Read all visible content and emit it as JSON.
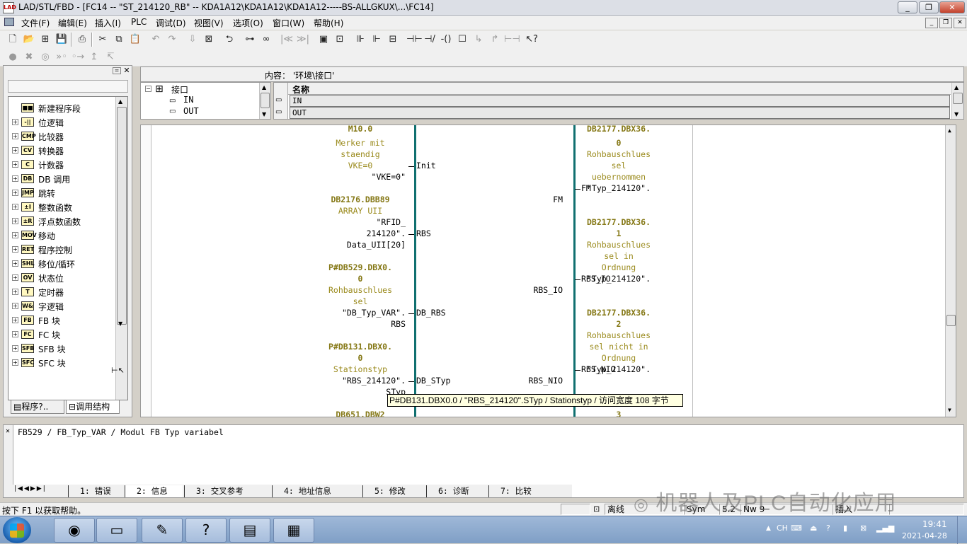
{
  "window": {
    "title": "LAD/STL/FBD  - [FC14 -- \"ST_214120_RB\" -- KDA1A12\\KDA1A12\\KDA1A12-----BS-ALLGKUX\\...\\FC14]",
    "app_icon_text": "LAD",
    "minimize": "_",
    "restore": "❐",
    "close": "✕"
  },
  "menu": {
    "items": [
      "文件(F)",
      "编辑(E)",
      "插入(I)",
      "PLC",
      "调试(D)",
      "视图(V)",
      "选项(O)",
      "窗口(W)",
      "帮助(H)"
    ],
    "mdi_min": "_",
    "mdi_restore": "❐",
    "mdi_close": "✕"
  },
  "left_panel": {
    "tree": [
      {
        "label": "新建程序段",
        "icon": "new-network-icon",
        "icon_text": "■■",
        "expandable": false
      },
      {
        "label": "位逻辑",
        "icon": "bit-logic-icon",
        "icon_text": "-||",
        "expandable": true
      },
      {
        "label": "比较器",
        "icon": "comparator-icon",
        "icon_text": "CMP",
        "expandable": true
      },
      {
        "label": "转换器",
        "icon": "converter-icon",
        "icon_text": "CV",
        "expandable": true
      },
      {
        "label": "计数器",
        "icon": "counter-icon",
        "icon_text": "C",
        "expandable": true
      },
      {
        "label": "DB 调用",
        "icon": "db-call-icon",
        "icon_text": "DB",
        "expandable": true
      },
      {
        "label": "跳转",
        "icon": "jump-icon",
        "icon_text": "JMP",
        "expandable": true
      },
      {
        "label": "整数函数",
        "icon": "integer-icon",
        "icon_text": "±I",
        "expandable": true
      },
      {
        "label": "浮点数函数",
        "icon": "float-icon",
        "icon_text": "±R",
        "expandable": true
      },
      {
        "label": "移动",
        "icon": "move-icon",
        "icon_text": "MOV",
        "expandable": true
      },
      {
        "label": "程序控制",
        "icon": "program-control-icon",
        "icon_text": "RET",
        "expandable": true
      },
      {
        "label": "移位/循环",
        "icon": "shift-icon",
        "icon_text": "SHL",
        "expandable": true
      },
      {
        "label": "状态位",
        "icon": "status-bit-icon",
        "icon_text": "OV",
        "expandable": true
      },
      {
        "label": "定时器",
        "icon": "timer-icon",
        "icon_text": "T",
        "expandable": true
      },
      {
        "label": "字逻辑",
        "icon": "word-logic-icon",
        "icon_text": "W&",
        "expandable": true
      },
      {
        "label": "FB 块",
        "icon": "fb-block-icon",
        "icon_text": "FB",
        "expandable": true
      },
      {
        "label": "FC 块",
        "icon": "fc-block-icon",
        "icon_text": "FC",
        "expandable": true
      },
      {
        "label": "SFB 块",
        "icon": "sfb-block-icon",
        "icon_text": "SFB",
        "expandable": true
      },
      {
        "label": "SFC 块",
        "icon": "sfc-block-icon",
        "icon_text": "SFC",
        "expandable": true
      }
    ],
    "tabs": [
      "程序?..",
      "调用结构"
    ]
  },
  "content_bar": {
    "text": "内容：  '环境\\接口'"
  },
  "interface_tree": {
    "root": "接口",
    "children": [
      "IN",
      "OUT"
    ]
  },
  "name_table": {
    "header": "名称",
    "rows": [
      "IN",
      "OUT"
    ]
  },
  "ladder": {
    "left": [
      {
        "text": "M10.0",
        "cls": "olive b"
      },
      {
        "text": "Merker mit",
        "cls": "olive"
      },
      {
        "text": "staendig",
        "cls": "olive"
      },
      {
        "text": "VKE=0",
        "cls": "olive"
      },
      {
        "text": "\"VKE=0\"",
        "cls": "blk"
      },
      {
        "text": "DB2176.DBB89",
        "cls": "olive b"
      },
      {
        "text": "ARRAY UII",
        "cls": "olive"
      },
      {
        "text": "\"RFID_",
        "cls": "blk"
      },
      {
        "text": "214120\".",
        "cls": "blk"
      },
      {
        "text": "Data_UII[20]",
        "cls": "blk"
      },
      {
        "text": "P#DB529.DBX0.",
        "cls": "olive b"
      },
      {
        "text": "0",
        "cls": "olive b"
      },
      {
        "text": "Rohbauschlues",
        "cls": "olive"
      },
      {
        "text": "sel",
        "cls": "olive"
      },
      {
        "text": "\"DB_Typ_VAR\".",
        "cls": "blk"
      },
      {
        "text": "RBS",
        "cls": "blk"
      },
      {
        "text": "P#DB131.DBX0.",
        "cls": "olive b"
      },
      {
        "text": "0",
        "cls": "olive b"
      },
      {
        "text": "Stationstyp",
        "cls": "olive"
      },
      {
        "text": "\"RBS_214120\".",
        "cls": "blk"
      },
      {
        "text": "STyp",
        "cls": "blk"
      },
      {
        "text": "DB651.DBW2",
        "cls": "olive b"
      }
    ],
    "pins_in": [
      "Init",
      "RBS",
      "DB_RBS",
      "DB_STyp"
    ],
    "pins_out": [
      "FM",
      "RBS_IO",
      "RBS_NIO"
    ],
    "right": [
      {
        "text": "DB2177.DBX36.",
        "cls": "olive b"
      },
      {
        "text": "0",
        "cls": "olive b"
      },
      {
        "text": "Rohbauschlues",
        "cls": "olive"
      },
      {
        "text": "sel",
        "cls": "olive"
      },
      {
        "text": "uebernommen",
        "cls": "olive"
      },
      {
        "text": "\"Typ_214120\".",
        "cls": "blk"
      },
      {
        "text": "FM",
        "cls": "blk"
      },
      {
        "text": "DB2177.DBX36.",
        "cls": "olive b"
      },
      {
        "text": "1",
        "cls": "olive b"
      },
      {
        "text": "Rohbauschlues",
        "cls": "olive"
      },
      {
        "text": "sel in",
        "cls": "olive"
      },
      {
        "text": "Ordnung",
        "cls": "olive"
      },
      {
        "text": "\"Typ_214120\".",
        "cls": "blk"
      },
      {
        "text": "RBS_IO",
        "cls": "blk"
      },
      {
        "text": "DB2177.DBX36.",
        "cls": "olive b"
      },
      {
        "text": "2",
        "cls": "olive b"
      },
      {
        "text": "Rohbauschlues",
        "cls": "olive"
      },
      {
        "text": "sel nicht in",
        "cls": "olive"
      },
      {
        "text": "Ordnung",
        "cls": "olive"
      },
      {
        "text": "\"Typ_214120\".",
        "cls": "blk"
      },
      {
        "text": "RBS_NIO",
        "cls": "blk"
      },
      {
        "text": "3",
        "cls": "olive b"
      }
    ],
    "tooltip": "P#DB131.DBX0.0 / \"RBS_214120\".STyp / Stationstyp / 访问宽度 108 字节"
  },
  "info_panel": {
    "text": "FB529 / FB_Typ_VAR / Modul FB Typ variabel",
    "tabs": [
      "1: 错误",
      "2: 信息",
      "3: 交叉参考",
      "4: 地址信息",
      "5: 修改",
      "6: 诊断",
      "7: 比较"
    ]
  },
  "status_bar": {
    "help": "按下 F1 以获取帮助。",
    "offline": "离线",
    "sym": "Sym",
    "ver": "5.2",
    "abs": "Nw 9",
    "insert": "插入"
  },
  "watermark": "机器人及PLC自动化应用",
  "taskbar": {
    "apps": [
      {
        "name": "chrome-icon",
        "glyph": "◉"
      },
      {
        "name": "file-explorer-icon",
        "glyph": "▭"
      },
      {
        "name": "simatic-manager-icon",
        "glyph": "✎"
      },
      {
        "name": "help-icon",
        "glyph": "?"
      },
      {
        "name": "scl-editor-icon",
        "glyph": "▤"
      },
      {
        "name": "lad-editor-icon",
        "glyph": "▦"
      }
    ],
    "lang": "CH",
    "time": "19:41",
    "date": "2021-04-28"
  }
}
